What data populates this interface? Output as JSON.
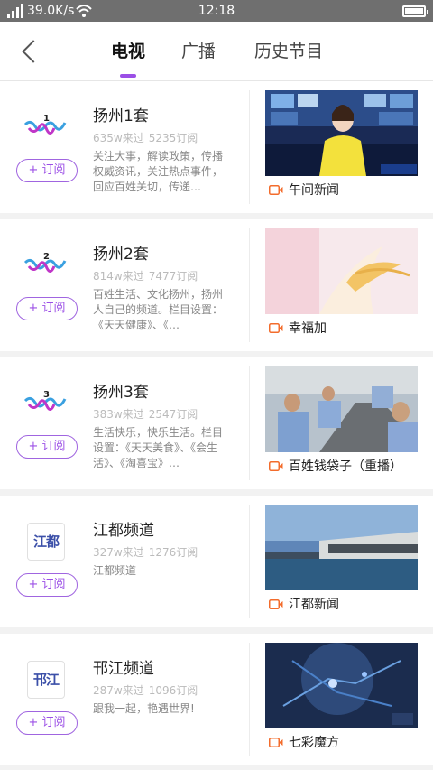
{
  "status_bar": {
    "network_speed": "39.0K/s",
    "time": "12:18"
  },
  "header": {
    "tabs": [
      {
        "label": "电视",
        "active": true
      },
      {
        "label": "广播",
        "active": false
      },
      {
        "label": "历史节目",
        "active": false
      }
    ]
  },
  "accent_color": "#9b4fe6",
  "channels": [
    {
      "name": "扬州1套",
      "logo_mark": "1",
      "logo_style": "wave",
      "visits": "635w来过",
      "subs": "5235订阅",
      "desc": "关注大事，解读政策，传播权威资讯，关注热点事件，回应百姓关切，传递…",
      "subscribe_label": "+ 订阅",
      "program": "午间新闻"
    },
    {
      "name": "扬州2套",
      "logo_mark": "2",
      "logo_style": "wave",
      "visits": "814w来过",
      "subs": "7477订阅",
      "desc": "百姓生活、文化扬州，扬州人自己的频道。栏目设置：《天天健康》、《…",
      "subscribe_label": "+ 订阅",
      "program": "幸福加"
    },
    {
      "name": "扬州3套",
      "logo_mark": "3",
      "logo_style": "wave",
      "visits": "383w来过",
      "subs": "2547订阅",
      "desc": "生活快乐，快乐生活。栏目设置：《天天美食》、《会生活》、《淘喜宝》…",
      "subscribe_label": "+ 订阅",
      "program": "百姓钱袋子（重播）"
    },
    {
      "name": "江都频道",
      "logo_mark": "江都",
      "logo_style": "box",
      "visits": "327w来过",
      "subs": "1276订阅",
      "desc": "江都频道",
      "subscribe_label": "+ 订阅",
      "program": "江都新闻"
    },
    {
      "name": "邗江频道",
      "logo_mark": "邗江",
      "logo_style": "box",
      "visits": "287w来过",
      "subs": "1096订阅",
      "desc": "跟我一起，艳遇世界!",
      "subscribe_label": "+ 订阅",
      "program": "七彩魔方"
    }
  ]
}
